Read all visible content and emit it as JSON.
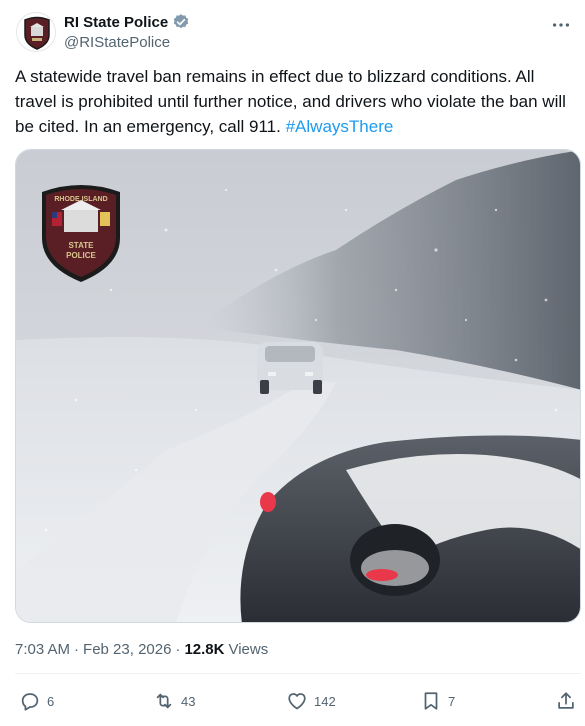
{
  "author": {
    "display_name": "RI State Police",
    "handle": "@RIStatePolice",
    "verified": true,
    "avatar_icon": "state-police-badge-icon",
    "avatar_colors": {
      "shield": "#5a1f24",
      "border": "#1b1b1b"
    }
  },
  "tweet": {
    "text_prefix": "A statewide travel ban remains in effect due to blizzard conditions. All travel is prohibited until further notice, and drivers who violate the ban will be cited. In an emergency, call 911. ",
    "hashtag": "#AlwaysThere"
  },
  "media": {
    "overlay_badge": {
      "lettering_top": "RHODE ISLAND",
      "lettering_bottom_1": "STATE",
      "lettering_bottom_2": "POLICE"
    }
  },
  "meta": {
    "time": "7:03 AM",
    "separator": "·",
    "date": "Feb 23, 2026",
    "views_count": "12.8K",
    "views_label": "Views"
  },
  "actions": {
    "replies": "6",
    "reposts": "43",
    "likes": "142",
    "bookmarks": "7"
  },
  "colors": {
    "link": "#1d9bf0",
    "muted": "#536471",
    "text": "#0f1419"
  }
}
